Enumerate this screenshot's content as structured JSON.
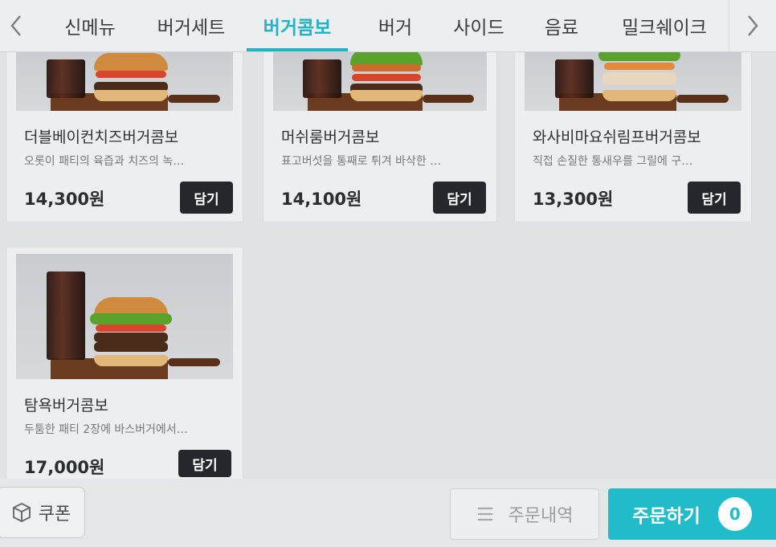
{
  "tabs": {
    "prev_icon": "chevron-left-icon",
    "next_icon": "chevron-right-icon",
    "items": [
      "신메뉴",
      "버거세트",
      "버거콤보",
      "버거",
      "사이드",
      "음료",
      "밀크쉐이크"
    ],
    "active_index": 2
  },
  "products": [
    {
      "name": "더블베이컨치즈버거콤보",
      "desc": "오롯이 패티의 육즙과 치즈의 녹…",
      "price": "14,300원",
      "button": "담기"
    },
    {
      "name": "머쉬룸버거콤보",
      "desc": "표고버섯을 통째로 튀겨 바삭한 …",
      "price": "14,100원",
      "button": "담기"
    },
    {
      "name": "와사비마요쉬림프버거콤보",
      "desc": "직접 손질한 통새우를 그릴에 구…",
      "price": "13,300원",
      "button": "담기"
    },
    {
      "name": "탐욕버거콤보",
      "desc": "두툼한 패티 2장에 바스버거에서…",
      "price": "17,000원",
      "button": "담기"
    }
  ],
  "bottom": {
    "coupon_label": "쿠폰",
    "coupon_icon": "coupon-icon",
    "orders_label": "주문내역",
    "orders_icon": "list-icon",
    "order_label": "주문하기",
    "cart_count": "0"
  },
  "colors": {
    "accent": "#20bcc9",
    "button_dark": "#24272b"
  }
}
